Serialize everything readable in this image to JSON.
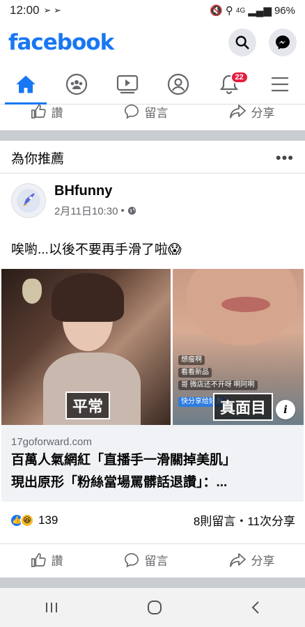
{
  "status_bar": {
    "time": "12:00",
    "network": "4G",
    "battery": "96%"
  },
  "header": {
    "logo": "facebook"
  },
  "nav": {
    "notifications_badge": "22"
  },
  "prev_post_actions": {
    "like": "讚",
    "comment": "留言",
    "share": "分享"
  },
  "section": {
    "title": "為你推薦",
    "more": "•••"
  },
  "post": {
    "author": "BHfunny",
    "timestamp": "2月11日10:30",
    "dot": "•",
    "text": "唉喲...以後不要再手滑了啦😱",
    "image_left_label": "平常",
    "image_right_label": "真面目",
    "info": "i",
    "live_overlay": [
      "想瘦啊",
      "看看新品",
      "哥 微店还不开呀 啊阿啊",
      "快分享给好友"
    ],
    "link_domain": "17goforward.com",
    "link_title_line1": "百萬人氣網紅「直播手一滑關掉美肌」",
    "link_title_line2": "現出原形「粉絲當場罵髒話退讚」：...",
    "reaction_count": "139",
    "comments_shares": "8則留言・11次分享",
    "actions": {
      "like": "讚",
      "comment": "留言",
      "share": "分享"
    }
  },
  "colors": {
    "brand": "#1877f2",
    "badge": "#e41e3f",
    "divider": "#c9ccd1"
  }
}
